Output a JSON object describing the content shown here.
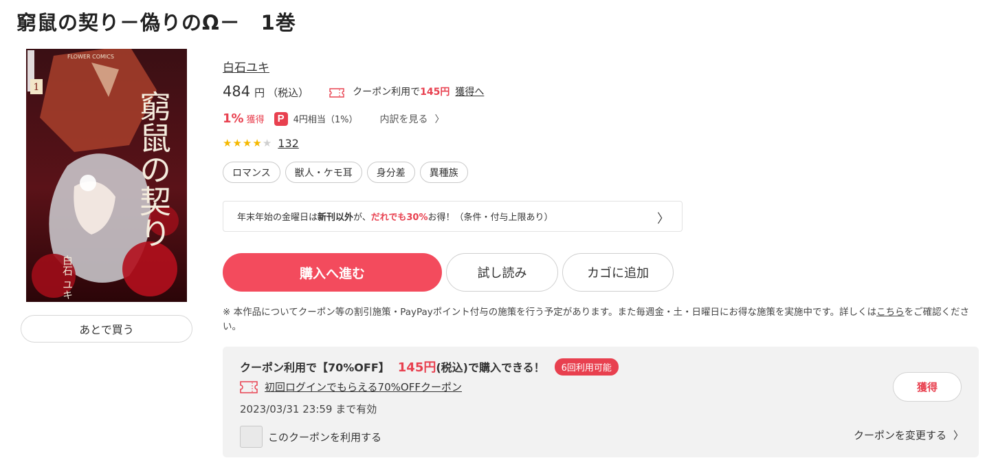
{
  "book": {
    "title": "窮鼠の契り－偽りのΩ－　1巻",
    "cover": {
      "alt": "窮鼠の契り 1巻 表紙",
      "label_publisher": "FLOWER COMICS",
      "label_volume": "1",
      "title_art": "窮鼠の契り",
      "author_art": "白石 ユキ"
    },
    "later_button": "あとで買う",
    "author": "白石ユキ"
  },
  "price": {
    "amount": "484",
    "unit": "円",
    "tax": "（税込）",
    "coupon_prefix": "クーポン利用で",
    "coupon_price": "145円",
    "coupon_link": "獲得へ"
  },
  "points": {
    "percent": "1%",
    "get_label": "獲得",
    "paypay_glyph": "P",
    "equivalent": "4円相当（1%）",
    "detail_link": "内訳を見る"
  },
  "rating": {
    "stars": 4,
    "max": 5,
    "review_count": "132"
  },
  "tags": [
    "ロマンス",
    "獣人・ケモ耳",
    "身分差",
    "異種族"
  ],
  "promo": {
    "part1": "年末年始の金曜日は",
    "part2": "新刊以外",
    "part3": "が、",
    "part4": "だれでも30%",
    "part5": "お得！（条件・付与上限あり）"
  },
  "actions": {
    "buy": "購入へ進む",
    "trial": "試し読み",
    "cart": "カゴに追加"
  },
  "notice": {
    "text": "※ 本作品についてクーポン等の割引施策・PayPayポイント付与の施策を行う予定があります。また毎週金・土・日曜日にお得な施策を実施中です。詳しくは",
    "link": "こちら",
    "tail": "をご確認ください。"
  },
  "coupon": {
    "head_prefix": "クーポン利用で【70%OFF】",
    "head_price": "145円",
    "head_suffix": "(税込)で購入できる！",
    "badge": "6回利用可能",
    "name": "初回ログインでもらえる70%OFFクーポン",
    "valid": "2023/03/31 23:59 まで有効",
    "checkbox_label": "このクーポンを利用する",
    "get_button": "獲得",
    "change_link": "クーポンを変更する"
  },
  "colors": {
    "accent": "#e8404f",
    "buy_button": "#f34b5d",
    "star": "#f5b800",
    "coupon_bg": "#f2f2f2"
  }
}
